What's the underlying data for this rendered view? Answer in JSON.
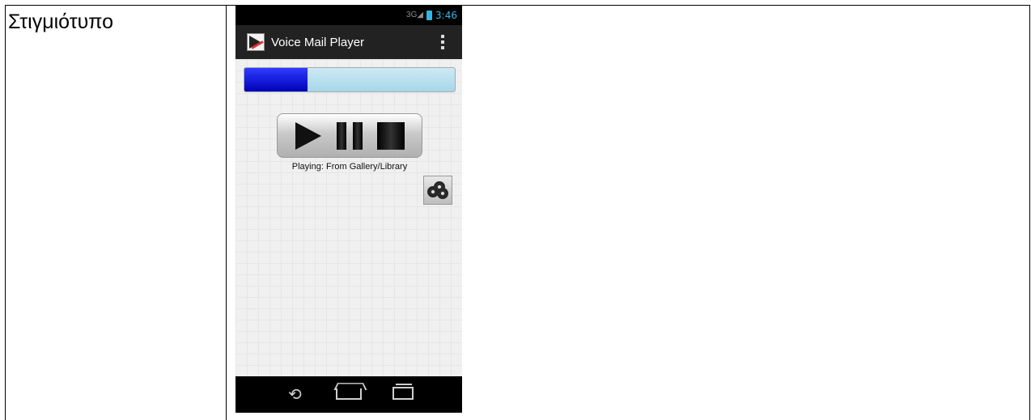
{
  "document": {
    "row_label": "Στιγμιότυπο"
  },
  "phone": {
    "status_bar": {
      "signal_icon": "signal-3g-icon",
      "battery_icon": "battery-icon",
      "time": "3:46"
    },
    "action_bar": {
      "app_icon": "voicemail-player-icon",
      "title": "Voice Mail Player",
      "overflow_icon": "overflow-menu-icon"
    },
    "player": {
      "progress_fraction": 0.3,
      "buttons": [
        "play-icon",
        "pause-icon",
        "stop-icon"
      ],
      "status_text": "Playing: From Gallery/Library",
      "gallery_icon": "film-reels-icon"
    },
    "nav_bar": {
      "icons": [
        "back-icon",
        "home-icon",
        "recent-apps-icon"
      ]
    },
    "colors": {
      "status_accent": "#33b5e5",
      "progress_fill": "#0000b8",
      "progress_track": "#a6d7e9",
      "action_bar": "#222222"
    }
  }
}
